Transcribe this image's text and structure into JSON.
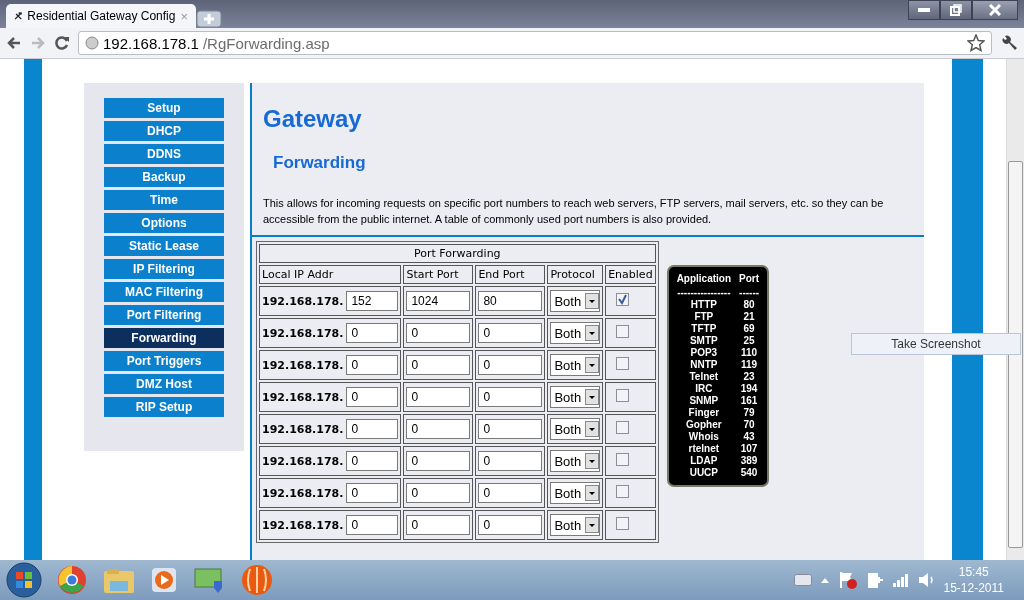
{
  "browser": {
    "tab_title": "Residential Gateway Config",
    "close": "×",
    "url_host": "192.168.178.1",
    "url_path": "/RgForwarding.asp"
  },
  "sidebar": [
    {
      "label": "Setup",
      "selected": false
    },
    {
      "label": "DHCP",
      "selected": false
    },
    {
      "label": "DDNS",
      "selected": false
    },
    {
      "label": "Backup",
      "selected": false
    },
    {
      "label": "Time",
      "selected": false
    },
    {
      "label": "Options",
      "selected": false
    },
    {
      "label": "Static Lease",
      "selected": false
    },
    {
      "label": "IP Filtering",
      "selected": false
    },
    {
      "label": "MAC Filtering",
      "selected": false
    },
    {
      "label": "Port Filtering",
      "selected": false
    },
    {
      "label": "Forwarding",
      "selected": true
    },
    {
      "label": "Port Triggers",
      "selected": false
    },
    {
      "label": "DMZ Host",
      "selected": false
    },
    {
      "label": "RIP Setup",
      "selected": false
    }
  ],
  "heading": "Gateway",
  "subheading": "Forwarding",
  "description": "This allows for incoming requests on specific port numbers to reach web servers, FTP servers, mail servers, etc. so they can be accessible from the public internet. A table of commonly used port numbers is also provided.",
  "table": {
    "title": "Port Forwarding",
    "columns": [
      "Local IP Addr",
      "Start Port",
      "End Port",
      "Protocol",
      "Enabled"
    ],
    "rows": [
      {
        "prefix": "192.168.178.",
        "ip": "152",
        "start": "1024",
        "end": "80",
        "protocol": "Both",
        "enabled": true
      },
      {
        "prefix": "192.168.178.",
        "ip": "0",
        "start": "0",
        "end": "0",
        "protocol": "Both",
        "enabled": false
      },
      {
        "prefix": "192.168.178.",
        "ip": "0",
        "start": "0",
        "end": "0",
        "protocol": "Both",
        "enabled": false
      },
      {
        "prefix": "192.168.178.",
        "ip": "0",
        "start": "0",
        "end": "0",
        "protocol": "Both",
        "enabled": false
      },
      {
        "prefix": "192.168.178.",
        "ip": "0",
        "start": "0",
        "end": "0",
        "protocol": "Both",
        "enabled": false
      },
      {
        "prefix": "192.168.178.",
        "ip": "0",
        "start": "0",
        "end": "0",
        "protocol": "Both",
        "enabled": false
      },
      {
        "prefix": "192.168.178.",
        "ip": "0",
        "start": "0",
        "end": "0",
        "protocol": "Both",
        "enabled": false
      },
      {
        "prefix": "192.168.178.",
        "ip": "0",
        "start": "0",
        "end": "0",
        "protocol": "Both",
        "enabled": false
      }
    ]
  },
  "ports": {
    "headers": [
      "Application",
      "Port"
    ],
    "rules": [
      "----------------",
      "------"
    ],
    "rows": [
      [
        "HTTP",
        "80"
      ],
      [
        "FTP",
        "21"
      ],
      [
        "TFTP",
        "69"
      ],
      [
        "SMTP",
        "25"
      ],
      [
        "POP3",
        "110"
      ],
      [
        "NNTP",
        "119"
      ],
      [
        "Telnet",
        "23"
      ],
      [
        "IRC",
        "194"
      ],
      [
        "SNMP",
        "161"
      ],
      [
        "Finger",
        "79"
      ],
      [
        "Gopher",
        "70"
      ],
      [
        "Whois",
        "43"
      ],
      [
        "rtelnet",
        "107"
      ],
      [
        "LDAP",
        "389"
      ],
      [
        "UUCP",
        "540"
      ]
    ]
  },
  "popup": "Take Screenshot",
  "clock": {
    "time": "15:45",
    "date": "15-12-2011"
  }
}
